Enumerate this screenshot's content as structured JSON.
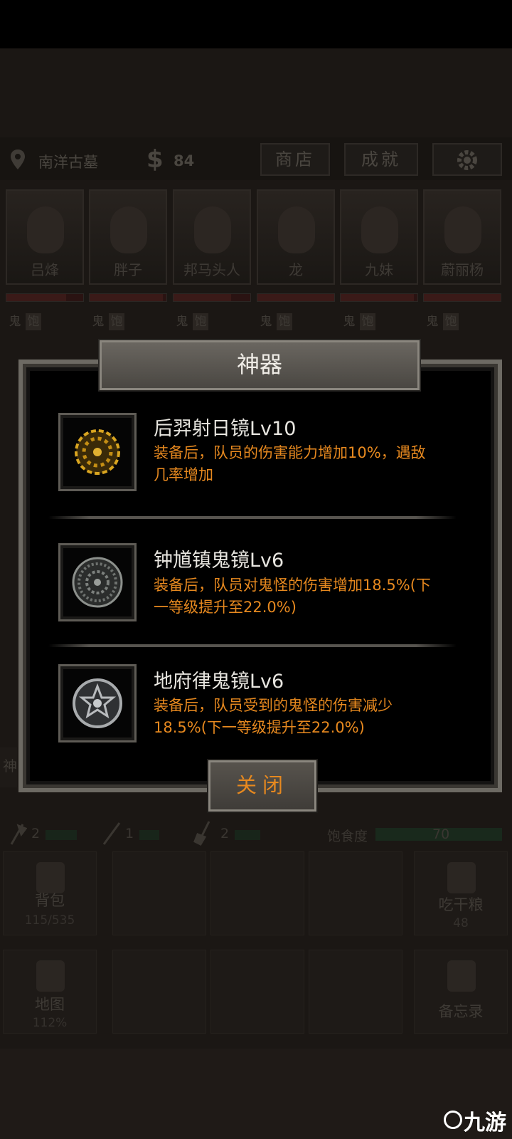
{
  "hud": {
    "location": "南洋古墓",
    "money": "84",
    "shop_label": "商店",
    "achievements_label": "成就",
    "settings_icon": "gear-icon",
    "location_icon": "map-pin-icon",
    "money_icon": "dollar-icon"
  },
  "party": [
    {
      "name": "吕烽",
      "tags": [
        "鬼",
        "饱"
      ],
      "hp": 0.78
    },
    {
      "name": "胖子",
      "tags": [
        "鬼",
        "饱"
      ],
      "hp": 0.95
    },
    {
      "name": "邦马头人",
      "tags": [
        "鬼",
        "饱"
      ],
      "hp": 0.75
    },
    {
      "name": "龙",
      "tags": [
        "鬼",
        "饱"
      ],
      "hp": 1.0
    },
    {
      "name": "九妹",
      "tags": [
        "鬼",
        "饱"
      ],
      "hp": 0.95
    },
    {
      "name": "蔚丽杨",
      "tags": [
        "鬼",
        "饱"
      ],
      "hp": 1.0
    }
  ],
  "modal": {
    "title": "神器",
    "items": [
      {
        "name": "后羿射日镜Lv10",
        "desc_line1": "装备后，队员的伤害能力增加10%，遇敌",
        "desc_line2": "几率增加",
        "icon": "gold-mirror-icon"
      },
      {
        "name": "钟馗镇鬼镜Lv6",
        "desc_line1": "装备后，队员对鬼怪的伤害增加18.5%(下",
        "desc_line2": "一等级提升至22.0%)",
        "icon": "bronze-mirror-icon"
      },
      {
        "name": "地府律鬼镜Lv6",
        "desc_line1": "装备后，队员受到的鬼怪的伤害减少",
        "desc_line2": "18.5%(下一等级提升至22.0%)",
        "icon": "silver-mirror-icon"
      }
    ],
    "close_label": "关闭"
  },
  "stats": {
    "axe": "2",
    "rope": "1",
    "shovel": "2",
    "satiety_label": "饱食度",
    "satiety_value": "70"
  },
  "tiles": {
    "bag_label": "背包",
    "bag_count": "115/535",
    "eat_label": "吃干粮",
    "eat_count": "48",
    "map_label": "地图",
    "map_percent": "112%",
    "memo_label": "备忘录"
  },
  "side_fragment": "神",
  "watermark": "九游"
}
